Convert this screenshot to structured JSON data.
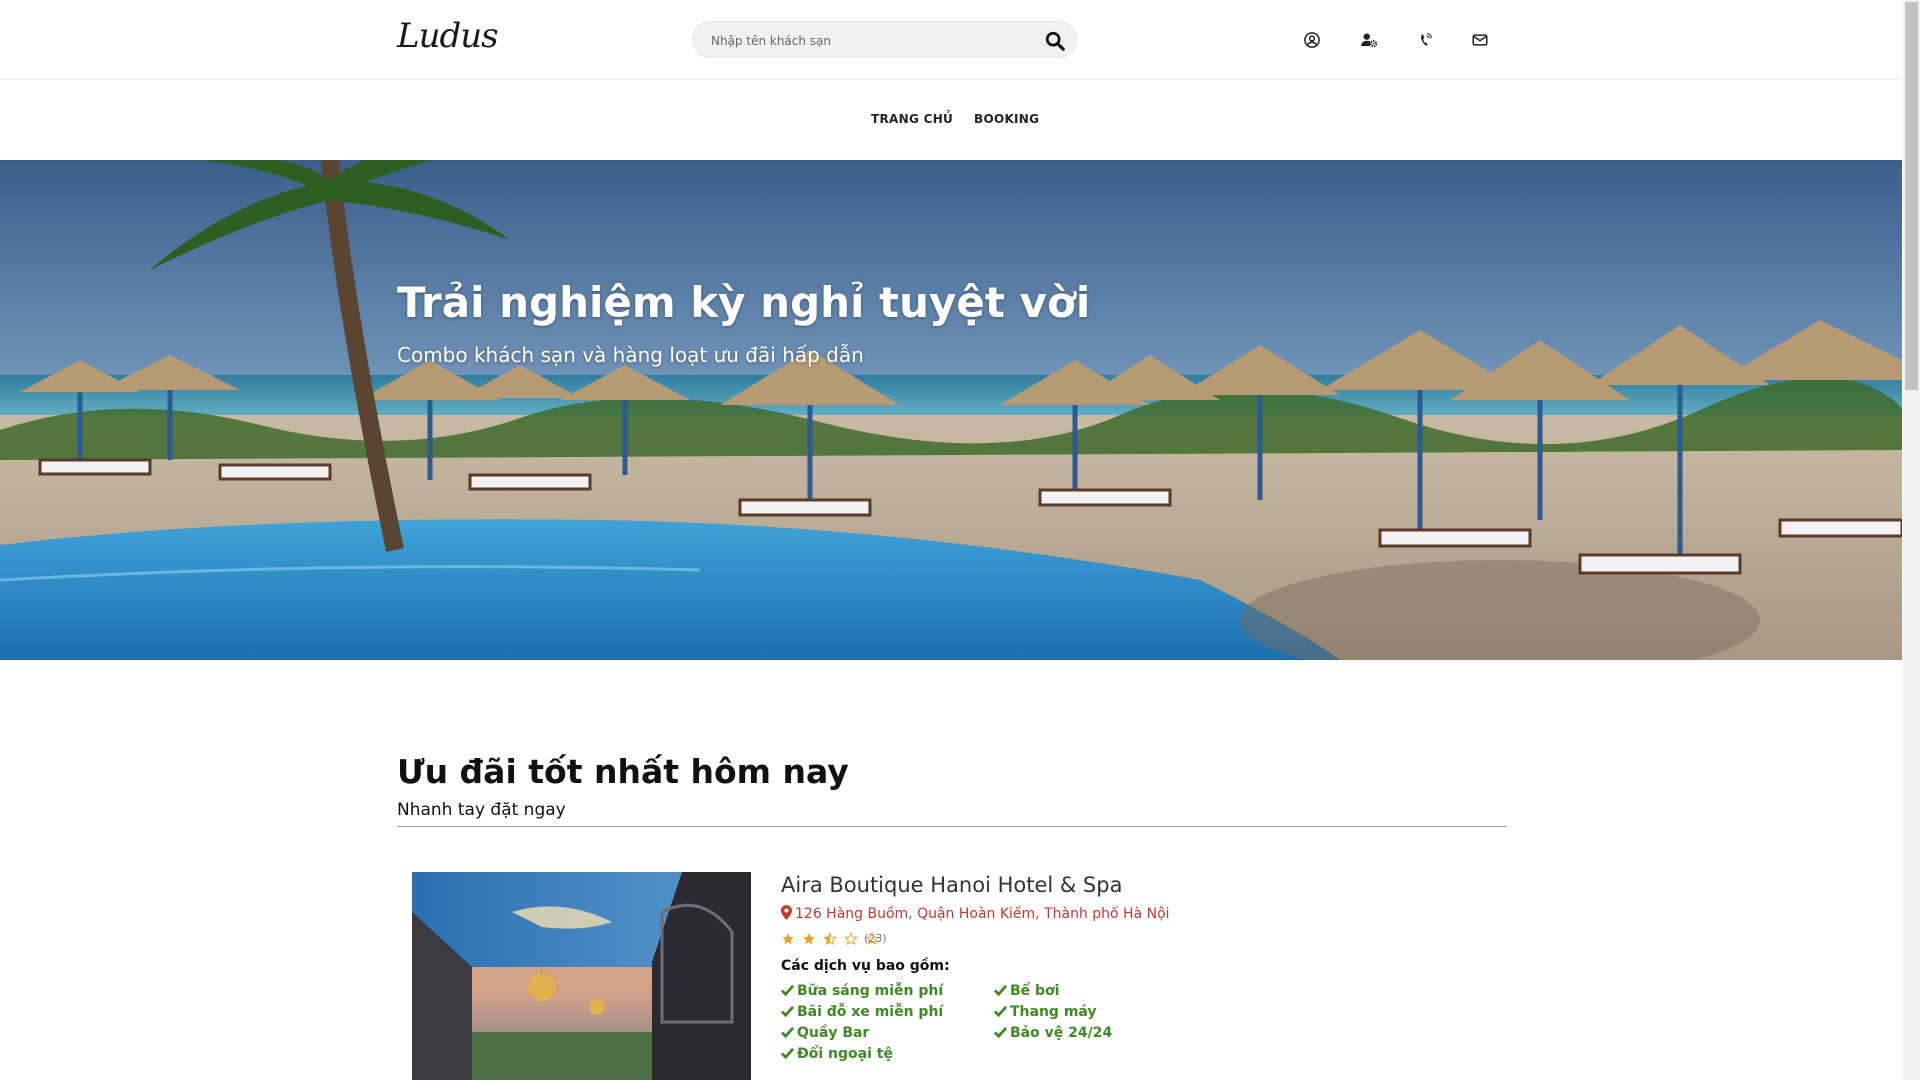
{
  "header": {
    "logo": "Ludus",
    "search_placeholder": "Nhập tên khách sạn",
    "icons": [
      "user-circle-icon",
      "user-settings-icon",
      "phone-icon",
      "mail-icon"
    ]
  },
  "nav": {
    "items": [
      {
        "label": "TRANG CHỦ"
      },
      {
        "label": "BOOKING"
      }
    ]
  },
  "hero": {
    "title": "Trải nghiệm kỳ nghỉ tuyệt vời",
    "subtitle": "Combo khách sạn và hàng loạt ưu đãi hấp dẫn"
  },
  "deals": {
    "title": "Ưu đãi tốt nhất hôm nay",
    "subtitle": "Nhanh tay đặt ngay"
  },
  "hotel": {
    "name": "Aira Boutique Hanoi Hotel & Spa",
    "address": "126 Hàng Buồm, Quận Hoàn Kiếm, Thành phố Hà Nội",
    "rating": 2.5,
    "rating_max": 5,
    "reviews": "(23)",
    "services_title": "Các dịch vụ bao gồm:",
    "services_col1": [
      "Bữa sáng miễn phí",
      "Bãi đỗ xe miễn phí",
      "Quầy Bar",
      "Đổi ngoại tệ"
    ],
    "services_col2": [
      "Bể bơi",
      "Thang máy",
      "Bảo vệ 24/24"
    ]
  },
  "colors": {
    "address_red": "#c0392b",
    "service_green": "#3d8b23",
    "star_orange": "#f0a020"
  }
}
